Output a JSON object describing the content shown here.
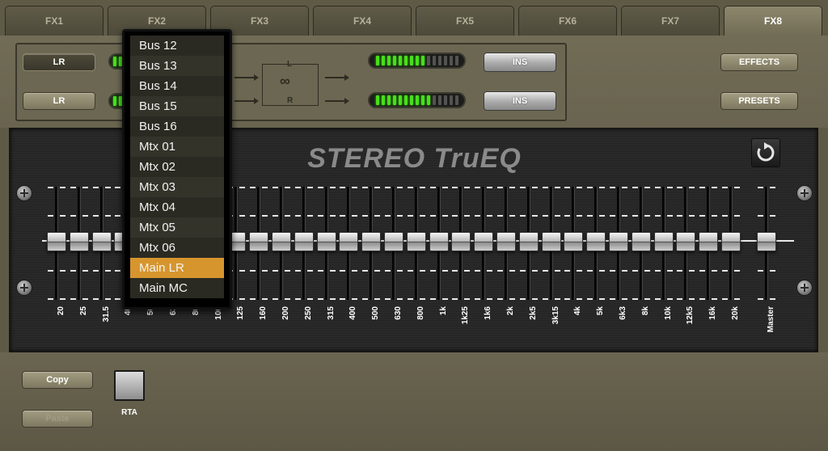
{
  "tabs": [
    {
      "label": "FX1",
      "active": false
    },
    {
      "label": "FX2",
      "active": false
    },
    {
      "label": "FX3",
      "active": false
    },
    {
      "label": "FX4",
      "active": false
    },
    {
      "label": "FX5",
      "active": false
    },
    {
      "label": "FX6",
      "active": false
    },
    {
      "label": "FX7",
      "active": false
    },
    {
      "label": "FX8",
      "active": true
    }
  ],
  "routing": {
    "source_1": "LR",
    "source_2": "LR",
    "insert_1": "INS",
    "insert_2": "INS",
    "link_left": "L",
    "link_right": "R",
    "link_symbol": "∞",
    "output_meter_1_lit": 9,
    "output_meter_2_lit": 10,
    "meter_segments": 15
  },
  "side_buttons": {
    "effects": "EFFECTS",
    "presets": "PRESETS"
  },
  "eq": {
    "title": "STEREO TruEQ",
    "reset_icon": "reset-icon",
    "bands": [
      "20",
      "25",
      "31.5",
      "40",
      "50",
      "63",
      "80",
      "100",
      "125",
      "160",
      "200",
      "250",
      "315",
      "400",
      "500",
      "630",
      "800",
      "1k",
      "1k25",
      "1k6",
      "2k",
      "2k5",
      "3k15",
      "4k",
      "5k",
      "6k3",
      "8k",
      "10k",
      "12k5",
      "16k",
      "20k"
    ],
    "master_label": "Master",
    "gains_db": [
      0,
      0,
      0,
      0,
      0,
      0,
      0,
      0,
      0,
      0,
      0,
      0,
      0,
      0,
      0,
      0,
      0,
      0,
      0,
      0,
      0,
      0,
      0,
      0,
      0,
      0,
      0,
      0,
      0,
      0,
      0
    ],
    "master_gain_db": 0
  },
  "bottom": {
    "copy": "Copy",
    "paste": "Paste",
    "rta": "RTA"
  },
  "dropdown": {
    "items": [
      "Bus 12",
      "Bus 13",
      "Bus 14",
      "Bus 15",
      "Bus 16",
      "Mtx 01",
      "Mtx 02",
      "Mtx 03",
      "Mtx 04",
      "Mtx 05",
      "Mtx 06",
      "Main LR",
      "Main MC"
    ],
    "selected": "Main LR"
  },
  "colors": {
    "accent": "#d7952e",
    "meter_on": "#47e01a",
    "panel": "#5e5a46"
  }
}
